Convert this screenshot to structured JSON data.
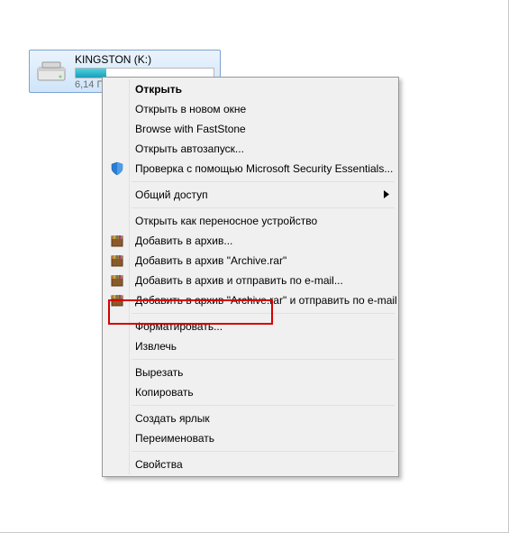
{
  "drive": {
    "name": "KINGSTON (K:)",
    "sub": "6,14 Г"
  },
  "menu": {
    "open": "Открыть",
    "open_new_window": "Открыть в новом окне",
    "browse_faststone": "Browse with FastStone",
    "autorun": "Открыть автозапуск...",
    "security_scan": "Проверка с помощью Microsoft Security Essentials...",
    "share": "Общий доступ",
    "open_portable": "Открыть как переносное устройство",
    "add_archive": "Добавить в архив...",
    "add_archive_named": "Добавить в архив \"Archive.rar\"",
    "add_archive_email": "Добавить в архив и отправить по e-mail...",
    "add_archive_named_email": "Добавить в архив \"Archive.rar\" и отправить по e-mail",
    "format": "Форматировать...",
    "eject": "Извлечь",
    "cut": "Вырезать",
    "copy": "Копировать",
    "shortcut": "Создать ярлык",
    "rename": "Переименовать",
    "properties": "Свойства"
  }
}
